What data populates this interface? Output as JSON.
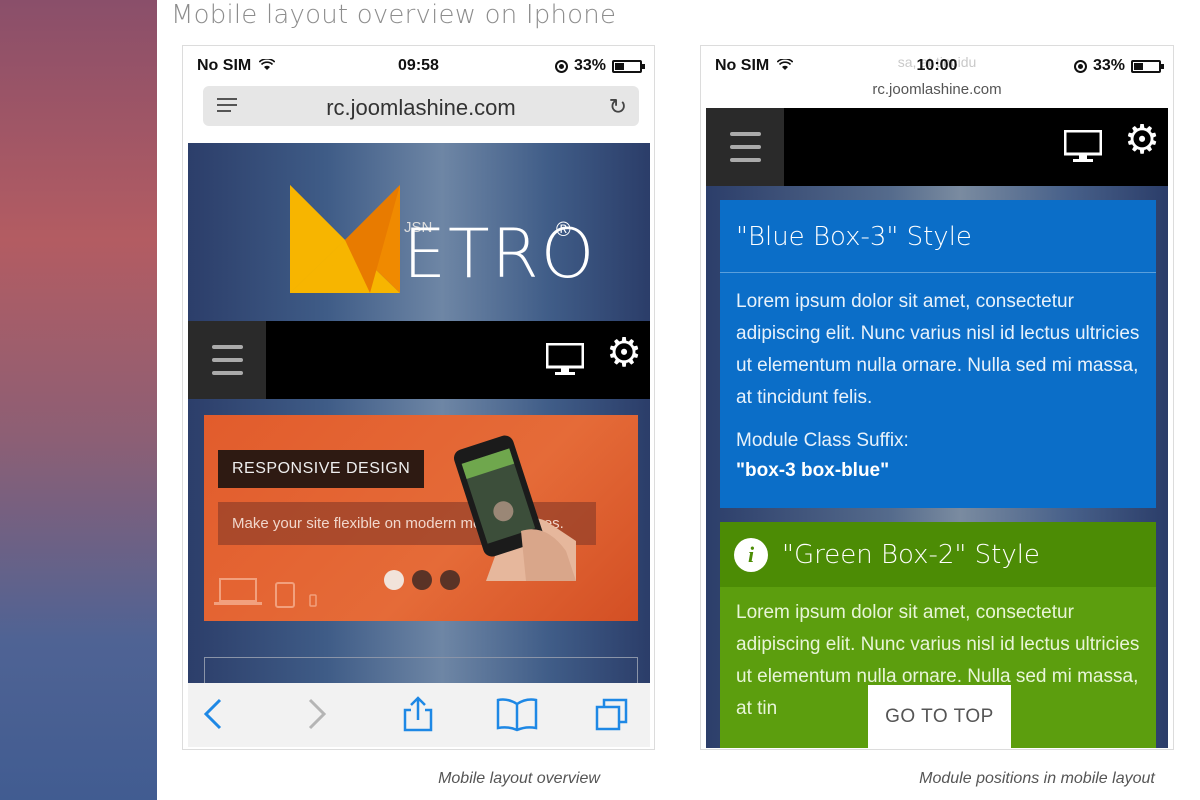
{
  "page": {
    "title": "Mobile layout overview on Iphone"
  },
  "left_phone": {
    "status": {
      "carrier": "No SIM",
      "time": "09:58",
      "battery": "33%",
      "battery_level": 0.33
    },
    "url": "rc.joomlashine.com",
    "logo": {
      "jsn": "JSN",
      "text": "ETRO",
      "reg": "®"
    },
    "banner": {
      "headline": "RESPONSIVE DESIGN",
      "description": "Make your site flexible on modern mobile devices.",
      "active_slide": 1,
      "slide_count": 3
    },
    "toolbar": [
      "back-icon",
      "forward-icon",
      "share-icon",
      "bookmarks-icon",
      "tabs-icon"
    ],
    "caption": "Mobile layout overview"
  },
  "right_phone": {
    "status": {
      "carrier": "No SIM",
      "time": "10:00",
      "battery": "33%",
      "battery_level": 0.33
    },
    "url": "rc.joomlashine.com",
    "ghost_text": "sa, at tincidu",
    "blue_box": {
      "title": "\"Blue Box-3\" Style",
      "body": "Lorem ipsum dolor sit amet, consectetur adipiscing elit. Nunc varius nisl id lectus ultricies ut elementum nulla ornare. Nulla sed mi massa, at tincidunt felis.",
      "suffix_label": "Module Class Suffix:",
      "suffix_value": "\"box-3 box-blue\""
    },
    "green_box": {
      "title": "\"Green Box-2\" Style",
      "body": "Lorem ipsum dolor sit amet, consectetur adipiscing elit. Nunc varius nisl id lectus ultricies ut elementum nulla ornare. Nulla sed mi massa, at tin"
    },
    "go_to_top": "GO TO TOP",
    "caption": "Module positions in mobile layout"
  },
  "colors": {
    "blue_box": "#0b6ec8",
    "green_box": "#5c9e0e",
    "banner": "#e25c2c",
    "logo_yellow": "#f7b500",
    "logo_orange": "#f08a00"
  }
}
